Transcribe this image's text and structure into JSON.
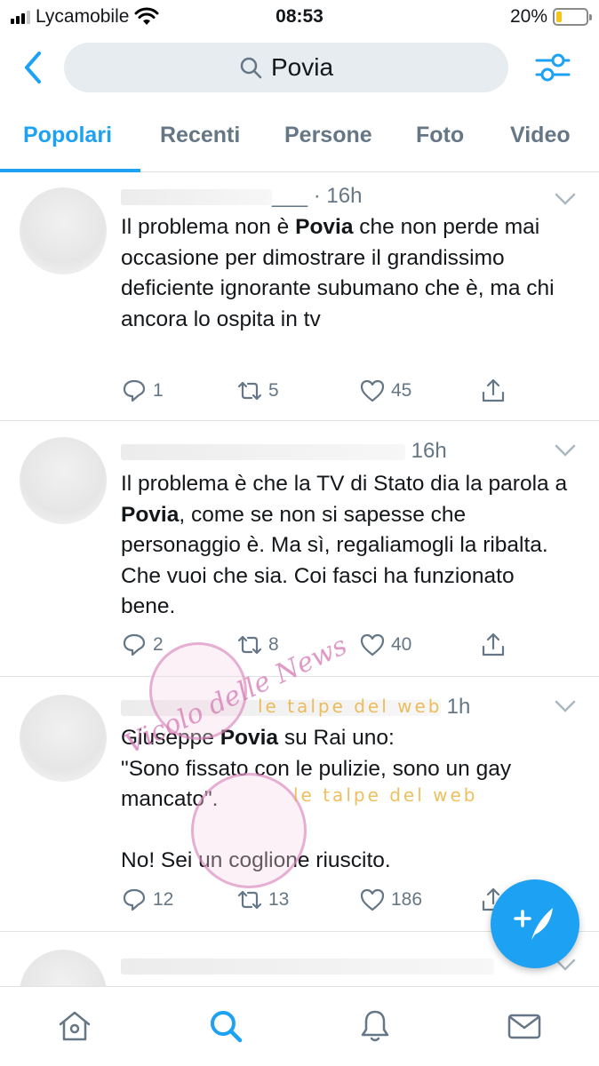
{
  "status_bar": {
    "carrier": "Lycamobile",
    "time": "08:53",
    "battery_percent": "20%",
    "battery_level": 0.2,
    "colors": {
      "battery": "#f5c518"
    }
  },
  "search": {
    "query": "Povia",
    "icons": {
      "back": "chevron-left-icon",
      "search": "search-icon",
      "filters": "sliders-icon"
    }
  },
  "tabs": [
    {
      "label": "Popolari",
      "active": true
    },
    {
      "label": "Recenti"
    },
    {
      "label": "Persone"
    },
    {
      "label": "Foto"
    },
    {
      "label": "Video"
    }
  ],
  "tweets": [
    {
      "handle_suffix": "___",
      "time": "· 16h",
      "text_before": "Il problema non è ",
      "highlight": "Povia",
      "text_after": " che non perde mai occasione per dimostrare il grandissimo deficiente ignorante subumano che è, ma chi ancora lo ospita in tv",
      "replies": "1",
      "retweets": "5",
      "likes": "45"
    },
    {
      "time": "16h",
      "text_before": "Il problema è che la TV di Stato dia la parola a ",
      "highlight": "Povia",
      "text_after": ", come se non si sapesse che personaggio è. Ma sì, regaliamogli la ribalta. Che vuoi che sia. Coi fasci ha funzionato bene.",
      "replies": "2",
      "retweets": "8",
      "likes": "40"
    },
    {
      "time": "1h",
      "text_before": "Giuseppe ",
      "highlight": "Povia",
      "text_after": " su Rai uno:\n\"Sono fissato con le pulizie, sono un gay mancato\".\n\nNo! Sei un coglione riuscito.",
      "replies": "12",
      "retweets": "13",
      "likes": "186"
    }
  ],
  "watermark": {
    "brand_a": "Vicolo delle News",
    "brand_b": "le talpe del web"
  },
  "fab": {
    "icon": "compose-tweet-icon"
  },
  "bottom_nav": [
    {
      "icon": "home-icon"
    },
    {
      "icon": "search-icon",
      "active": true
    },
    {
      "icon": "bell-icon"
    },
    {
      "icon": "mail-icon"
    }
  ],
  "colors": {
    "accent": "#1da1f2",
    "secondary_text": "#657786",
    "search_bg": "#e6ecf0"
  }
}
